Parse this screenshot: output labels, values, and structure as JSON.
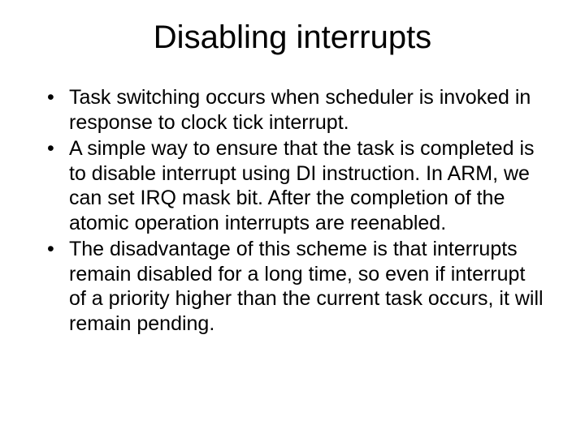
{
  "slide": {
    "title": "Disabling interrupts",
    "bullets": [
      "Task switching occurs when scheduler is invoked in response to clock tick interrupt.",
      "A simple way to ensure that the task is completed is to disable interrupt using DI instruction. In ARM, we can set IRQ mask bit. After the completion of the atomic operation interrupts are reenabled.",
      "The disadvantage of this scheme is that interrupts remain disabled for a long time, so even if interrupt of a priority higher than the current task occurs, it will remain pending."
    ]
  }
}
